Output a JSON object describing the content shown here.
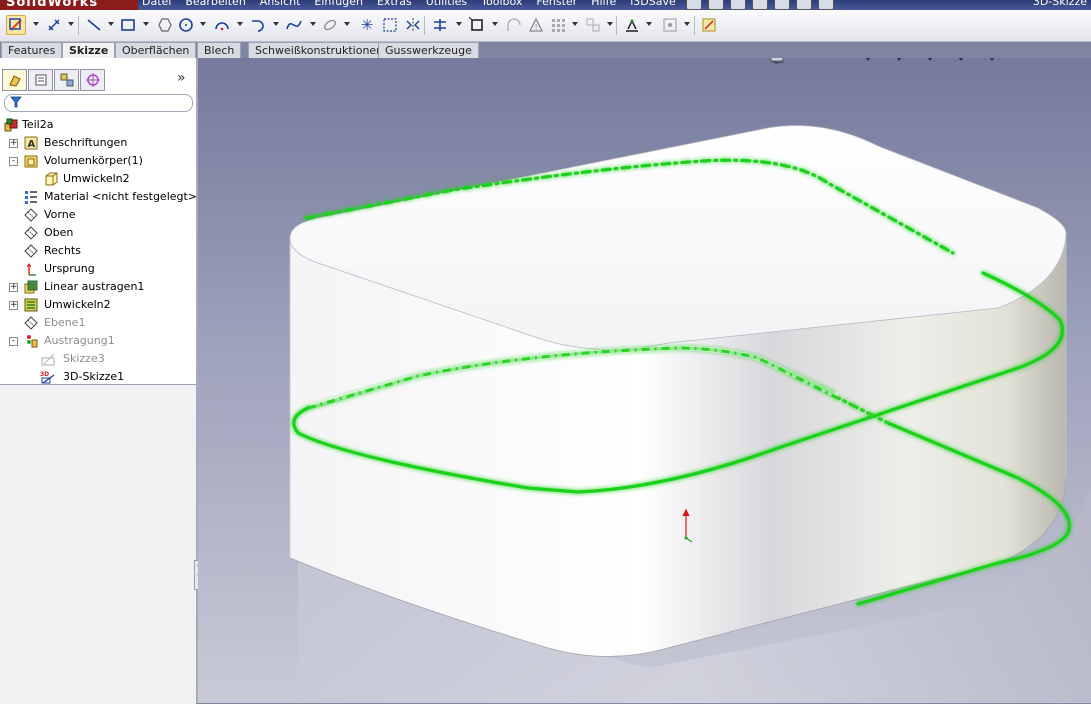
{
  "app": {
    "logo_text": "SolidWorks",
    "document_title": "3D-Skizze",
    "menus": [
      "Datei",
      "Bearbeiten",
      "Ansicht",
      "Einfügen",
      "Extras",
      "Utilities",
      "Toolbox",
      "Fenster",
      "Hilfe",
      "i3DSave"
    ]
  },
  "command_manager": {
    "tabs": [
      {
        "label": "Features",
        "active": false
      },
      {
        "label": "Skizze",
        "active": true
      },
      {
        "label": "Oberflächen",
        "active": false
      },
      {
        "label": "Blech",
        "active": false
      },
      {
        "label": "Schweißkonstruktionen",
        "active": false
      },
      {
        "label": "Gusswerkzeuge",
        "active": false
      }
    ]
  },
  "toolbar": {
    "tools": [
      "sketch-icon",
      "smart-dimension-icon",
      "line-icon",
      "rectangle-icon",
      "polygon-icon",
      "circle-icon",
      "arc-icon",
      "tangent-arc-icon",
      "spline-icon",
      "ellipse-icon",
      "point-icon",
      "construction-geometry-icon",
      "mirror-icon",
      "offset-icon",
      "trim-icon",
      "display-relations-icon",
      "linear-pattern-icon",
      "move-entities-icon",
      "repair-sketch-icon",
      "quick-snaps-icon",
      "rapid-sketch-icon"
    ]
  },
  "feature_manager": {
    "more_label": "»",
    "tree": [
      {
        "label": "Teil2a",
        "icon": "part-icon",
        "expander": "",
        "indent": 0,
        "grey": false
      },
      {
        "label": "Beschriftungen",
        "icon": "annotations-icon",
        "expander": "+",
        "indent": 1,
        "grey": false
      },
      {
        "label": "Volumenkörper(1)",
        "icon": "solid-bodies-folder-icon",
        "expander": "-",
        "indent": 1,
        "grey": false
      },
      {
        "label": "Umwickeln2",
        "icon": "body-icon",
        "expander": "",
        "indent": 2,
        "grey": false
      },
      {
        "label": "Material <nicht festgelegt>",
        "icon": "material-icon",
        "expander": "",
        "indent": 1,
        "grey": false
      },
      {
        "label": "Vorne",
        "icon": "plane-icon",
        "expander": "",
        "indent": 1,
        "grey": false
      },
      {
        "label": "Oben",
        "icon": "plane-icon",
        "expander": "",
        "indent": 1,
        "grey": false
      },
      {
        "label": "Rechts",
        "icon": "plane-icon",
        "expander": "",
        "indent": 1,
        "grey": false
      },
      {
        "label": "Ursprung",
        "icon": "origin-icon",
        "expander": "",
        "indent": 1,
        "grey": false
      },
      {
        "label": "Linear austragen1",
        "icon": "extrude-icon",
        "expander": "+",
        "indent": 1,
        "grey": false
      },
      {
        "label": "Umwickeln2",
        "icon": "wrap-icon",
        "expander": "+",
        "indent": 1,
        "grey": false
      },
      {
        "label": "Ebene1",
        "icon": "plane-icon",
        "expander": "",
        "indent": 1,
        "grey": true
      },
      {
        "label": "Austragung1",
        "icon": "sweep-icon",
        "expander": "-",
        "indent": 1,
        "grey": true
      },
      {
        "label": "Skizze3",
        "icon": "sketch-icon",
        "expander": "",
        "indent": 2,
        "grey": true
      },
      {
        "label": "3D-Skizze1",
        "icon": "3d-sketch-icon",
        "expander": "",
        "indent": 2,
        "grey": false
      }
    ]
  },
  "colors": {
    "sketch_green": "#1fd11a",
    "viewport_top": "#75799c",
    "viewport_bottom": "#c9cad6",
    "selected_tab": "#f2f2f4"
  }
}
